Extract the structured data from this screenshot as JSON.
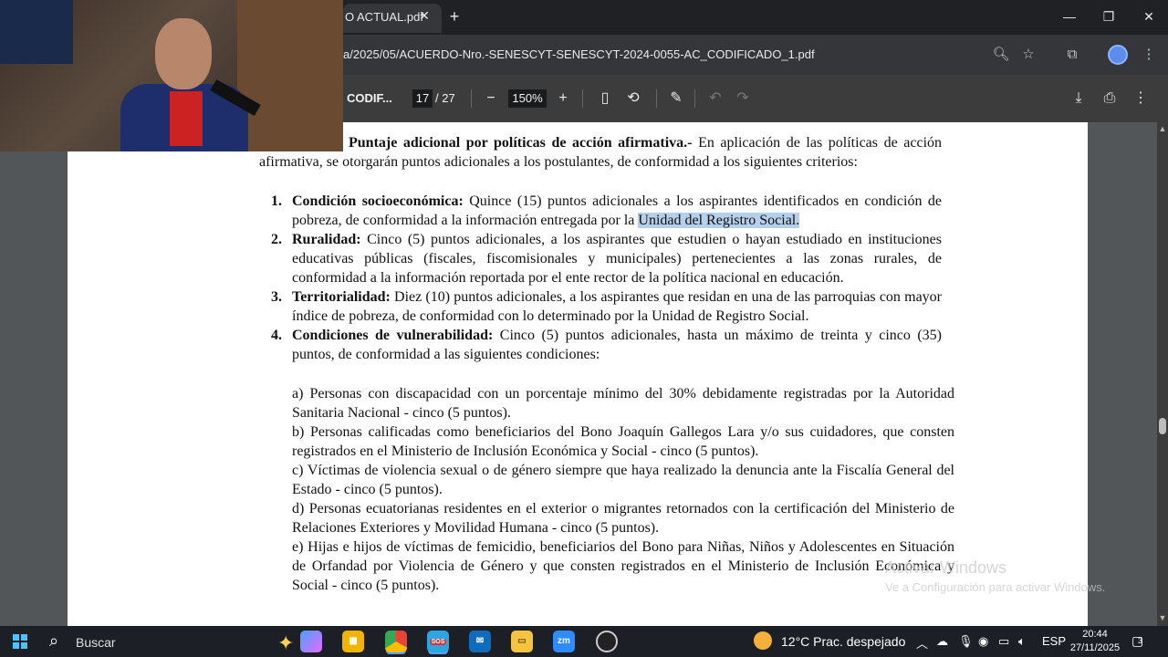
{
  "browser": {
    "tab_title": "O ACTUAL.pdf",
    "tab_close": "✕",
    "new_tab": "+",
    "url": "a/2025/05/ACUERDO-Nro.-SENESCYT-SENESCYT-2024-0055-AC_CODIFICADO_1.pdf"
  },
  "pdf_toolbar": {
    "doc_title": "CODIF...",
    "current_page": "17",
    "total_pages": "/ 27",
    "zoom": "150%"
  },
  "document": {
    "intro_heading": "Puntaje adicional por políticas de acción afirmativa.-",
    "intro_rest_line1": " En aplicación de las políticas de",
    "intro_body": "acción afirmativa, se otorgarán puntos adicionales a los postulantes, de conformidad a los siguientes criterios:",
    "items": [
      {
        "num": "1.",
        "title": "Condición socioeconómica:",
        "text": " Quince (15) puntos adicionales a los aspirantes identificados en condición de pobreza, de conformidad a la información entregada por la ",
        "highlight": "Unidad del Registro Social."
      },
      {
        "num": "2.",
        "title": "Ruralidad:",
        "text": " Cinco (5) puntos adicionales, a los aspirantes que estudien o hayan estudiado en instituciones educativas públicas (fiscales, fiscomisionales y municipales) pertenecientes a las zonas rurales, de conformidad a la información reportada por el ente rector de la política nacional en educación."
      },
      {
        "num": "3.",
        "title": "Territorialidad:",
        "text": " Diez (10) puntos adicionales, a los aspirantes que residan en una de las parroquias con mayor índice de pobreza, de conformidad con lo determinado por la Unidad de Registro Social."
      },
      {
        "num": "4.",
        "title": "Condiciones de vulnerabilidad:",
        "text": " Cinco (5) puntos adicionales, hasta un máximo de treinta y cinco (35) puntos, de conformidad a las siguientes condiciones:"
      }
    ],
    "subitems": [
      "a) Personas con discapacidad con un porcentaje mínimo del 30% debidamente registradas por la Autoridad Sanitaria Nacional - cinco (5 puntos).",
      "b) Personas calificadas como beneficiarios del Bono Joaquín Gallegos Lara y/o sus cuidadores, que consten registrados en el Ministerio de Inclusión Económica y Social - cinco (5 puntos).",
      "c) Víctimas de violencia sexual o de género siempre que haya realizado la denuncia ante la Fiscalía General del Estado - cinco (5 puntos).",
      "d) Personas ecuatorianas residentes en el exterior o migrantes retornados con la certificación del Ministerio de Relaciones Exteriores y Movilidad Humana - cinco (5 puntos).",
      "e) Hijas e hijos de víctimas de femicidio, beneficiarios del Bono para Niñas, Niños y Adolescentes en Situación de Orfandad por Violencia de Género y que consten registrados en el Ministerio de Inclusión Económica y Social - cinco (5 puntos)."
    ]
  },
  "watermark": {
    "line1": "Activar Windows",
    "line2": "Ve a Configuración para activar Windows."
  },
  "taskbar": {
    "search_placeholder": "Buscar",
    "badge": "SOS",
    "zoom_label": "zm",
    "temperature": "12°C",
    "weather_desc": "Prac. despejado",
    "lang": "ESP",
    "time": "20:44",
    "date": "27/11/2025",
    "notifications": "3"
  }
}
